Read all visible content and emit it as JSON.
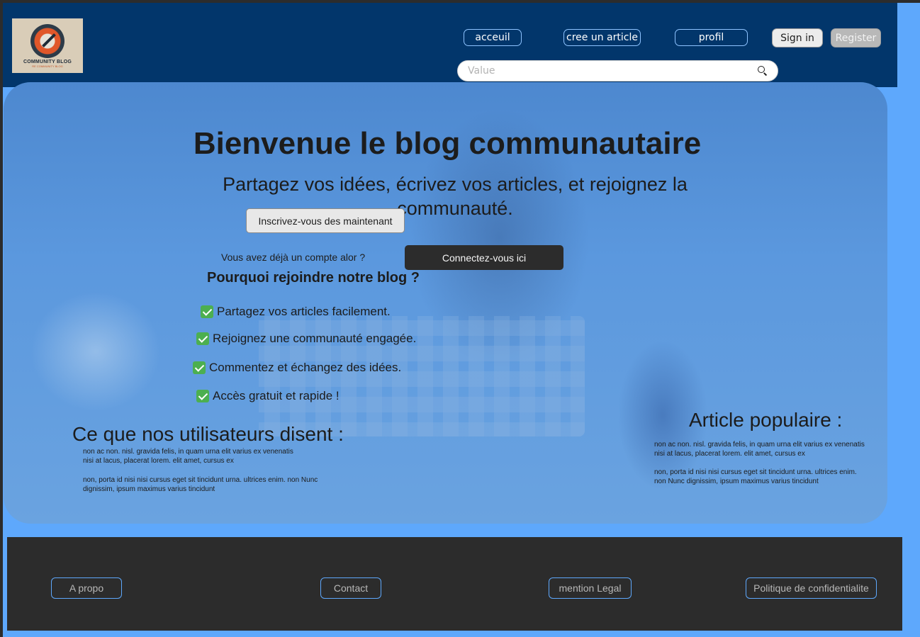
{
  "header": {
    "logo": {
      "title": "COMMUNITY BLOG",
      "subtitle": "RE COMMUNITY BLOG"
    },
    "nav": [
      {
        "label": "acceuil"
      },
      {
        "label": "cree un article"
      },
      {
        "label": "profil"
      }
    ],
    "signin_label": "Sign in",
    "register_label": "Register",
    "search": {
      "placeholder": "Value"
    }
  },
  "hero": {
    "title": "Bienvenue le blog communautaire",
    "subtitle": "Partagez vos idées, écrivez vos articles, et rejoignez la communauté.",
    "signup_button": "Inscrivez-vous des maintenant",
    "account_text": "Vous avez déjà un compte alor  ?",
    "connect_button": "Connectez-vous ici",
    "why_title": "Pourquoi rejoindre notre blog ?",
    "benefits": [
      "Partagez vos articles facilement.",
      "Rejoignez une communauté engagée.",
      "Commentez et échangez des idées.",
      "Accès gratuit et rapide !"
    ]
  },
  "testimonials": {
    "title": "Ce que nos utilisateurs disent :",
    "paragraphs": [
      "non ac non. nisl. gravida felis, in quam urna elit varius ex venenatis nisi at lacus, placerat lorem. elit amet, cursus ex",
      "non, porta id nisi nisi cursus eget sit tincidunt urna. ultrices enim. non Nunc dignissim, ipsum maximus varius tincidunt"
    ]
  },
  "popular": {
    "title": "Article populaire :",
    "paragraphs": [
      "non ac non. nisl. gravida felis, in quam urna elit varius ex venenatis nisi at lacus, placerat lorem. elit amet, cursus ex",
      "non, porta id nisi nisi cursus eget sit tincidunt urna. ultrices enim. non Nunc dignissim, ipsum maximus varius tincidunt"
    ]
  },
  "footer": {
    "links": [
      {
        "label": "A propo"
      },
      {
        "label": "Contact"
      },
      {
        "label": "mention Legal"
      },
      {
        "label": "Politique de confidentialite"
      }
    ]
  },
  "colors": {
    "header_bg": "#02366b",
    "page_bg": "#5ea8fc",
    "footer_bg": "#2c2c2c",
    "check_green": "#4caf50"
  }
}
